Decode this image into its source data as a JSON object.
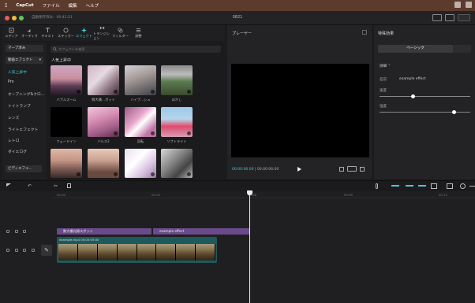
{
  "menubar": {
    "app": "CapCut",
    "file": "ファイル",
    "edit": "編集",
    "help": "ヘルプ"
  },
  "window": {
    "title": "0821",
    "autosave": "自動保存済み：00:41:21"
  },
  "toolbar": {
    "tools": [
      "メディア",
      "オーディオ",
      "テキスト",
      "ステッカー",
      "エフェクト",
      "トランジション",
      "フィルター",
      "調整"
    ],
    "active": "エフェクト"
  },
  "sidebar": {
    "top_button": "マーブ済み",
    "dropdown": "動画エフェクト",
    "items": [
      "人気上昇中",
      "Pro",
      "オープニング&クロ…",
      "トイトランプ",
      "レンズ",
      "ライトエフェクト",
      "レトロ",
      "ダイエログ",
      "ビディエフェ…"
    ]
  },
  "effects": {
    "search_placeholder": "エフェクトを検索",
    "section": "人気上昇中",
    "items": [
      {
        "label": "バブルズーム"
      },
      {
        "label": "鮮大橋…ボット"
      },
      {
        "label": "ハイプ…シュ"
      },
      {
        "label": "ぼかし"
      },
      {
        "label": "フェードイン"
      },
      {
        "label": "バルス2"
      },
      {
        "label": "回転"
      },
      {
        "label": "ソフトライト"
      },
      {
        "label": ""
      },
      {
        "label": ""
      },
      {
        "label": ""
      },
      {
        "label": ""
      }
    ]
  },
  "player": {
    "title": "プレーヤー",
    "time_current": "00:00:06:00",
    "time_total": "00:00:06:00"
  },
  "properties": {
    "title": "特殊効果",
    "tab": "ベーシック",
    "section": "詳細",
    "effect_label": "名前",
    "effect_name": "example effect",
    "slider1_label": "速度",
    "slider2_label": "強度",
    "slider1_value": 0.35,
    "slider2_value": 0.8
  },
  "timeline": {
    "ticks": [
      "00:00",
      "00:03",
      "00:06",
      "00:09",
      "00:12"
    ],
    "text_clip_1": "鮮大橋光線スポット",
    "text_clip_2": "example effect",
    "video_label": "example.mp4  00:00:05:00"
  }
}
